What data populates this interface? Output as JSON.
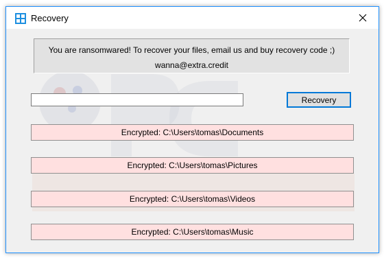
{
  "window": {
    "title": "Recovery"
  },
  "message": {
    "line1": "You are ransomwared! To recover your files, email us and buy recovery code ;)",
    "line2": "wanna@extra.credit"
  },
  "form": {
    "code_value": "",
    "button_label": "Recovery"
  },
  "encrypted_list": [
    "Encrypted: C:\\Users\\tomas\\Documents",
    "Encrypted: C:\\Users\\tomas\\Pictures",
    "Encrypted: C:\\Users\\tomas\\Videos",
    "Encrypted: C:\\Users\\tomas\\Music"
  ],
  "colors": {
    "accent": "#0078d7",
    "encrypted_bg": "#ffe0e0"
  }
}
